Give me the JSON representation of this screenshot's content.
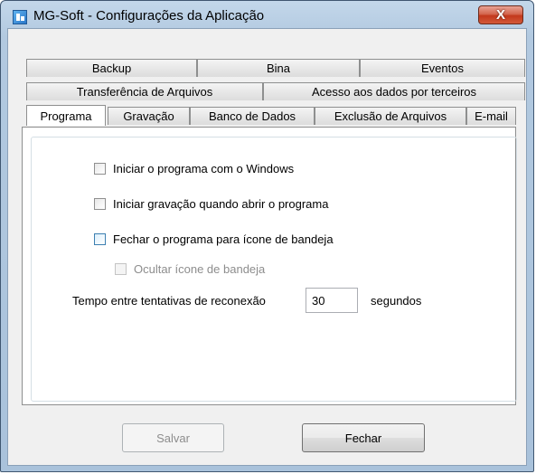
{
  "window": {
    "title": "MG-Soft - Configurações da Aplicação",
    "close_glyph": "X"
  },
  "tabs": {
    "row1": [
      "Backup",
      "Bina",
      "Eventos"
    ],
    "row2": [
      "Transferência de Arquivos",
      "Acesso aos dados por terceiros"
    ],
    "row3": [
      "Programa",
      "Gravação",
      "Banco de Dados",
      "Exclusão de Arquivos",
      "E-mail"
    ],
    "active": "Programa"
  },
  "options": {
    "start_with_windows": {
      "label": "Iniciar o programa com o Windows",
      "checked": false
    },
    "start_recording": {
      "label": "Iniciar gravação quando abrir o programa",
      "checked": false
    },
    "close_to_tray": {
      "label": "Fechar o programa para ícone de bandeja",
      "checked": false
    },
    "hide_tray_icon": {
      "label": "Ocultar ícone de bandeja",
      "checked": false,
      "enabled": false
    }
  },
  "reconnect": {
    "label": "Tempo entre tentativas de reconexão",
    "value": "30",
    "unit": "segundos"
  },
  "buttons": {
    "save": "Salvar",
    "close": "Fechar"
  },
  "icons": {
    "app": "app-icon",
    "close": "close-icon"
  }
}
